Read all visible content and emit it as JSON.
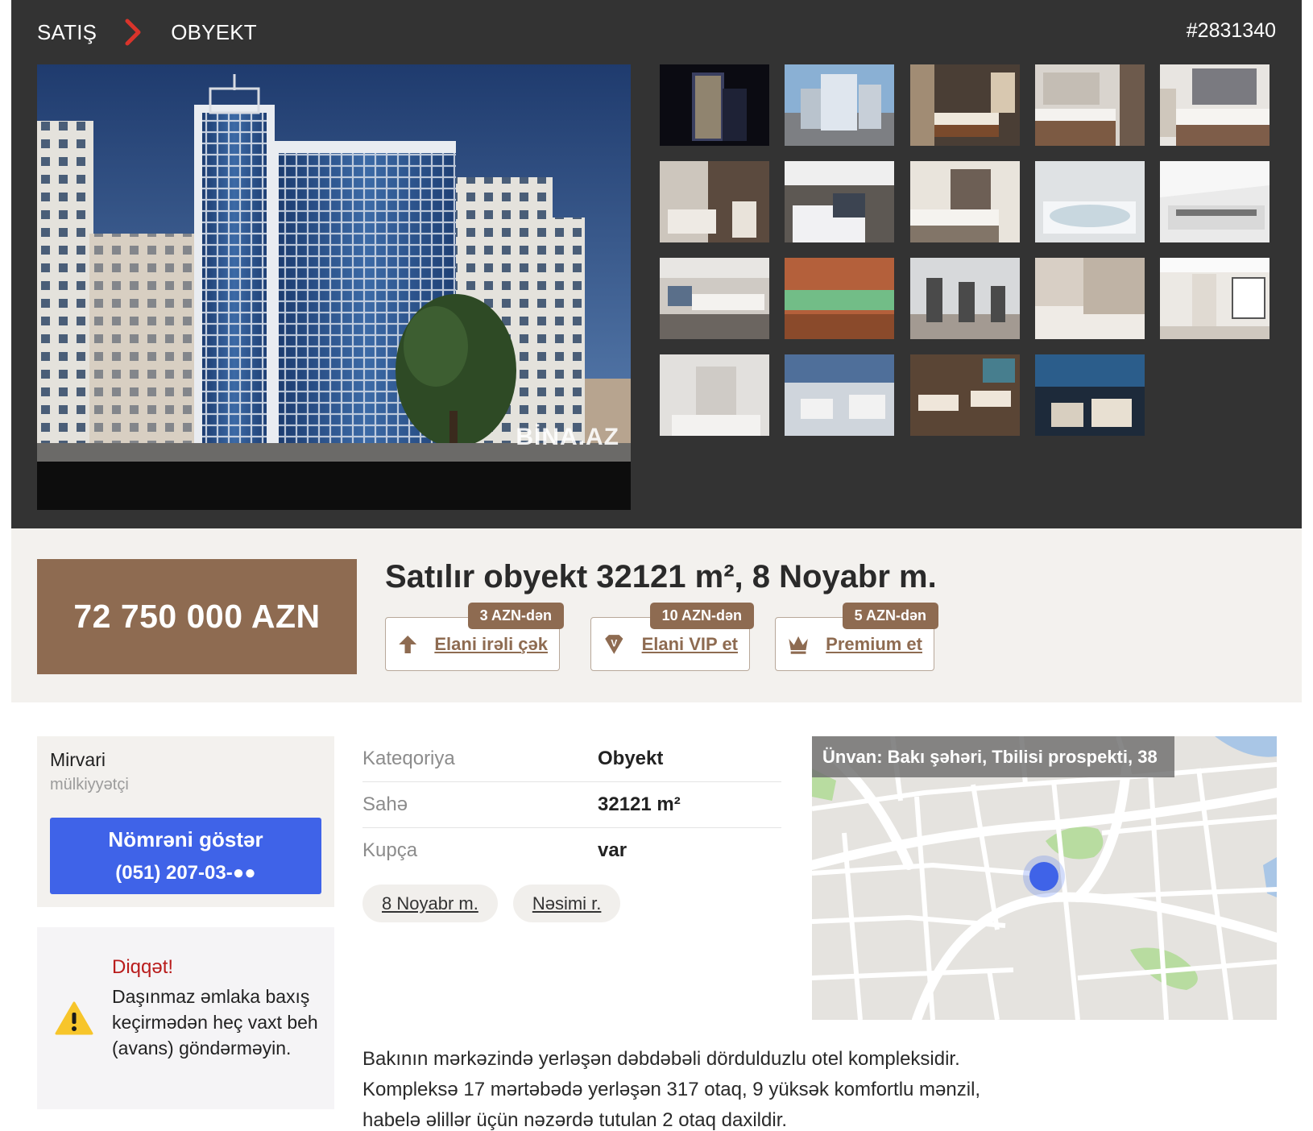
{
  "header": {
    "breadcrumb": [
      {
        "label": "SATIŞ"
      },
      {
        "label": "OBYEKT"
      }
    ],
    "listing_id": "#2831340"
  },
  "gallery": {
    "watermark": "BİNA.AZ",
    "thumbnail_count": 19
  },
  "listing": {
    "price": "72 750 000 AZN",
    "title": "Satılır obyekt 32121 m², 8 Noyabr m."
  },
  "promotions": [
    {
      "label": "Elani irəli çək",
      "price_tag": "3 AZN-dən",
      "icon": "arrow-up-icon"
    },
    {
      "label": "Elani VIP et",
      "price_tag": "10 AZN-dən",
      "icon": "vip-diamond-icon"
    },
    {
      "label": "Premium et",
      "price_tag": "5 AZN-dən",
      "icon": "crown-icon"
    }
  ],
  "owner": {
    "name": "Mirvari",
    "role": "mülkiyyətçi",
    "show_number_label": "Nömrəni göstər",
    "phone_masked": "(051) 207-03-●●"
  },
  "warning": {
    "title": "Diqqət!",
    "text": "Daşınmaz əmlaka baxış keçirmədən heç vaxt beh (avans) göndərməyin."
  },
  "params": [
    {
      "key": "Kateqoriya",
      "value": "Obyekt"
    },
    {
      "key": "Sahə",
      "value": "32121 m²"
    },
    {
      "key": "Kupça",
      "value": "var"
    }
  ],
  "location_chips": [
    {
      "label": "8 Noyabr m."
    },
    {
      "label": "Nəsimi r."
    }
  ],
  "map": {
    "address": "Ünvan: Bakı şəhəri, Tbilisi prospekti, 38"
  },
  "description": "Bakının mərkəzində yerləşən dəbdəbəli dördulduzlu otel kompleksidir. Kompleksə 17 mərtəbədə yerləşən 317 otaq, 9 yüksək komfortlu mənzil, habelə əlillər üçün nəzərdə tutulan 2 otaq daxildir.",
  "colors": {
    "header_bg": "#333333",
    "brand_brown": "#8e6b51",
    "band_bg": "#f3f1ee",
    "phone_button": "#3f63e8",
    "warning_title": "#b91c1c",
    "breadcrumb_chevron": "#d9342b"
  }
}
